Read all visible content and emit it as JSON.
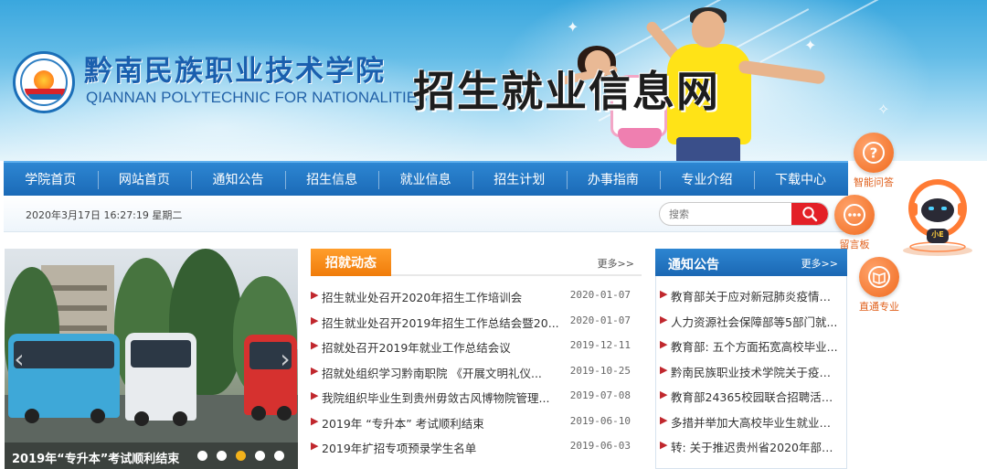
{
  "header": {
    "school_name_cn": "黔南民族职业技术学院",
    "school_name_en": "QIANNAN POLYTECHNIC FOR NATIONALITIES",
    "site_name": "招生就业信息网"
  },
  "nav": {
    "items": [
      {
        "label": "学院首页"
      },
      {
        "label": "网站首页"
      },
      {
        "label": "通知公告"
      },
      {
        "label": "招生信息"
      },
      {
        "label": "就业信息"
      },
      {
        "label": "招生计划"
      },
      {
        "label": "办事指南"
      },
      {
        "label": "专业介绍"
      },
      {
        "label": "下载中心"
      }
    ]
  },
  "infobar": {
    "datetime": "2020年3月17日  16:27:19  星期二",
    "search_placeholder": "搜索"
  },
  "slider": {
    "caption": "2019年“专升本”考试顺利结束",
    "active_index": 2,
    "dot_count": 5
  },
  "news": {
    "tab_label": "招就动态",
    "more_label": "更多>>",
    "items": [
      {
        "title": "招生就业处召开2020年招生工作培训会",
        "date": "2020-01-07"
      },
      {
        "title": "招生就业处召开2019年招生工作总结会暨20...",
        "date": "2020-01-07"
      },
      {
        "title": "招就处召开2019年就业工作总结会议",
        "date": "2019-12-11"
      },
      {
        "title": "招就处组织学习黔南职院 《开展文明礼仪...",
        "date": "2019-10-25"
      },
      {
        "title": "我院组织毕业生到贵州毋敛古风博物院管理...",
        "date": "2019-07-08"
      },
      {
        "title": "2019年 “专升本” 考试顺利结束",
        "date": "2019-06-10"
      },
      {
        "title": "2019年扩招专项预录学生名单",
        "date": "2019-06-03"
      }
    ]
  },
  "notices": {
    "tab_label": "通知公告",
    "more_label": "更多>>",
    "items": [
      {
        "title": "教育部关于应对新冠肺炎疫情做..."
      },
      {
        "title": "人力资源社会保障部等5部门就..."
      },
      {
        "title": "教育部: 五个方面拓宽高校毕业..."
      },
      {
        "title": "黔南民族职业技术学院关于疫情..."
      },
      {
        "title": "教育部24365校园联合招聘活动..."
      },
      {
        "title": "多措并举加大高校毕业生就业工..."
      },
      {
        "title": "转: 关于推迟贵州省2020年部分..."
      }
    ]
  },
  "tools": {
    "qa_label": "智能问答",
    "message_label": "留言板",
    "major_label": "直通专业",
    "robot_badge": "小E"
  },
  "colors": {
    "nav_blue": "#1b6ab7",
    "accent_orange": "#f07c0a",
    "search_red": "#e32027",
    "bullet_red": "#c0272d"
  }
}
